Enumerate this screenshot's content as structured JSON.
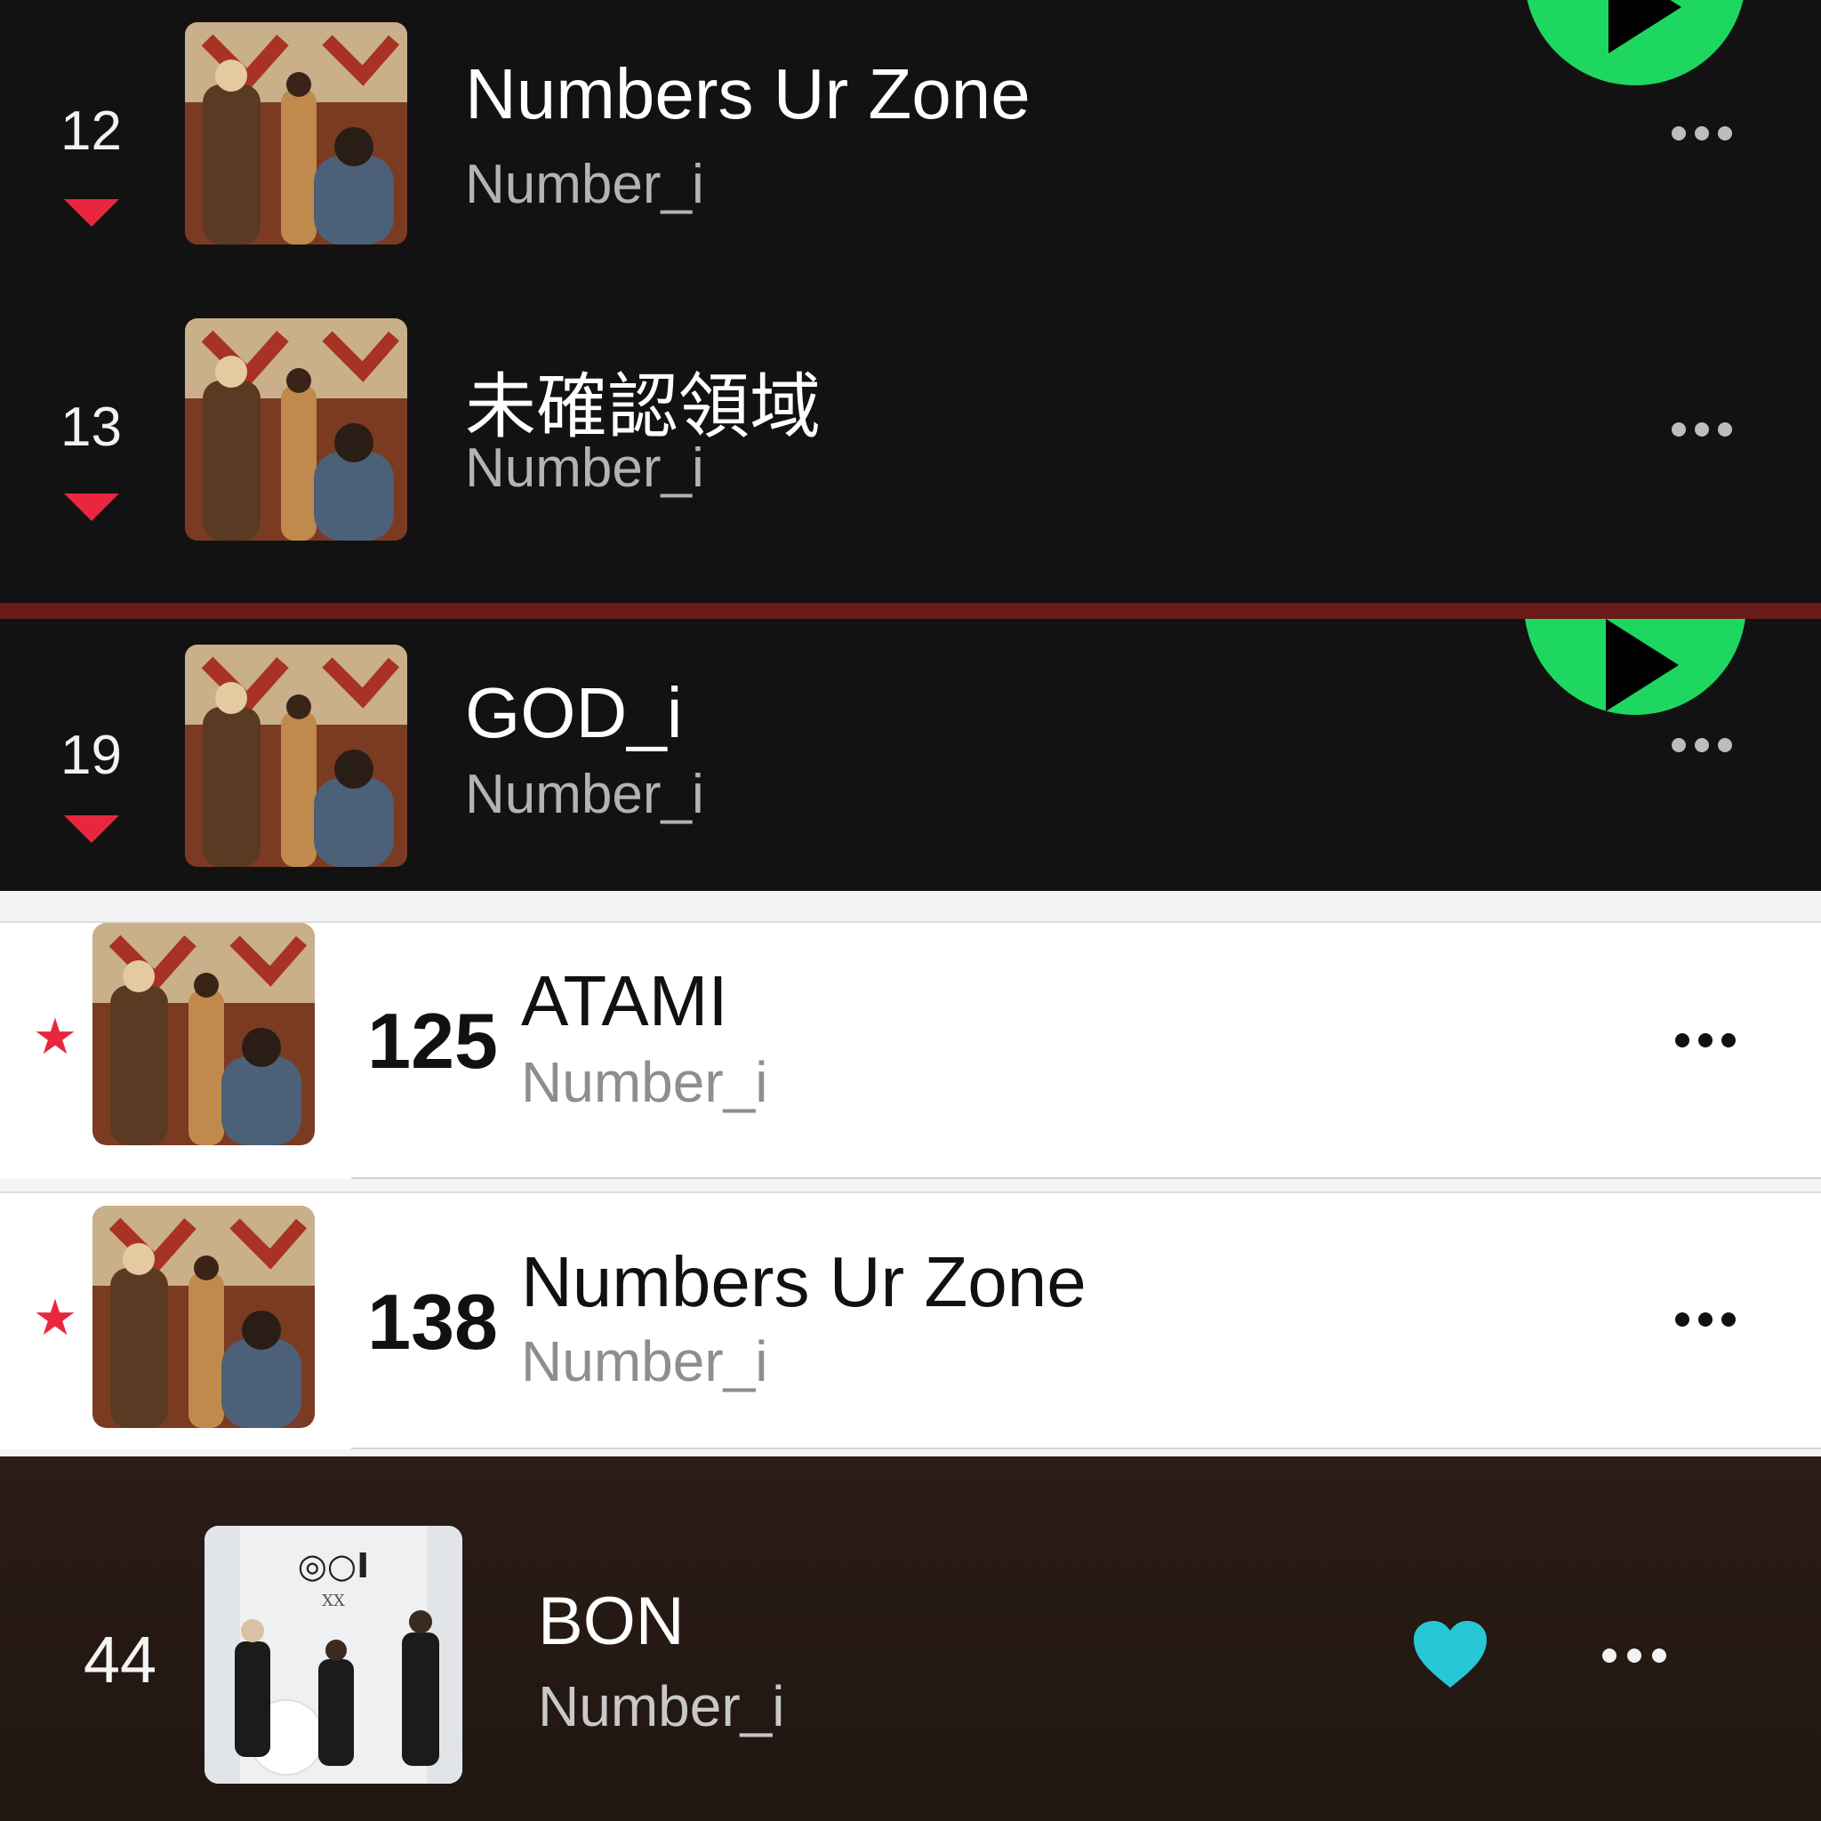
{
  "dark_chart": {
    "rows": [
      {
        "rank": "12",
        "title": "Numbers Ur Zone",
        "artist": "Number_i",
        "trend": "down"
      },
      {
        "rank": "13",
        "title": "未確認領域",
        "artist": "Number_i",
        "trend": "down"
      }
    ],
    "accent": "#1ed760",
    "down_color": "#e8273e"
  },
  "dark_chart_2": {
    "rows": [
      {
        "rank": "19",
        "title": "GOD_i",
        "artist": "Number_i",
        "trend": "down"
      }
    ]
  },
  "light_chart": {
    "rows": [
      {
        "position": "125",
        "title": "ATAMI",
        "artist": "Number_i",
        "badge": "star"
      },
      {
        "position": "138",
        "title": "Numbers Ur Zone",
        "artist": "Number_i",
        "badge": "star"
      }
    ],
    "badge_color": "#e8273e"
  },
  "player": {
    "rank": "44",
    "title": "BON",
    "artist": "Number_i",
    "liked": true,
    "heart_color": "#27c7d6"
  }
}
